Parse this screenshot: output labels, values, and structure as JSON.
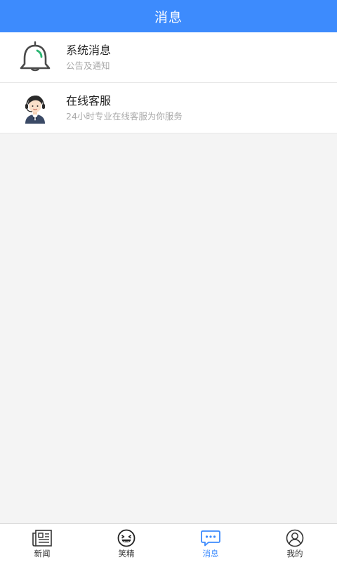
{
  "header": {
    "title": "消息"
  },
  "messages": [
    {
      "title": "系统消息",
      "subtitle": "公告及通知",
      "icon": "bell-icon"
    },
    {
      "title": "在线客服",
      "subtitle": "24小时专业在线客服为你服务",
      "icon": "customer-service-agent-icon"
    }
  ],
  "tabbar": {
    "tabs": [
      {
        "label": "新闻",
        "icon": "newspaper-icon",
        "active": false
      },
      {
        "label": "笑精",
        "icon": "laughing-face-icon",
        "active": false
      },
      {
        "label": "消息",
        "icon": "chat-bubble-icon",
        "active": true
      },
      {
        "label": "我的",
        "icon": "user-profile-icon",
        "active": false
      }
    ]
  },
  "colors": {
    "header_bg": "#3d8bfd",
    "active_tab": "#3d8bfd",
    "page_bg": "#f4f4f4",
    "bell_accent": "#2bb673"
  }
}
